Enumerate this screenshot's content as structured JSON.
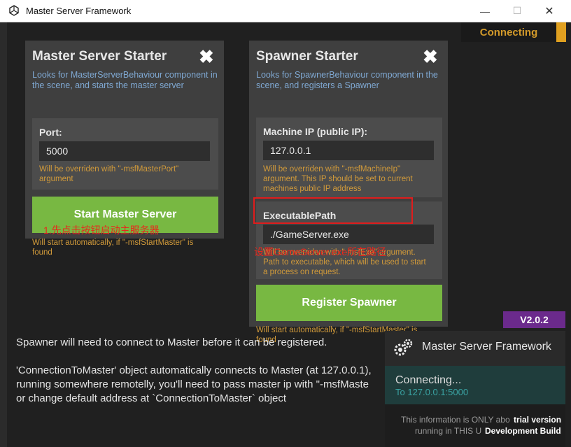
{
  "window": {
    "title": "Master Server Framework",
    "minimize_glyph": "—",
    "maximize_glyph": "☐",
    "close_glyph": "✕"
  },
  "top_status": {
    "text": "Connecting"
  },
  "master_panel": {
    "title": "Master Server Starter",
    "close_glyph": "✖",
    "description": "Looks for MasterServerBehaviour component in the scene, and starts the master server",
    "port_label": "Port:",
    "port_value": "5000",
    "port_warning": "Will be overriden with \"-msfMasterPort\" argument",
    "start_button": "Start Master Server",
    "auto_note": "Will start automatically, if \"-msfStartMaster\" is found",
    "annotation": "1.先点击按钮启动主服务器"
  },
  "spawner_panel": {
    "title": "Spawner Starter",
    "close_glyph": "✖",
    "description": "Looks for SpawnerBehaviour component in the scene, and registers a Spawner",
    "ip_label": "Machine IP (public IP):",
    "ip_value": "127.0.0.1",
    "ip_warning": "Will be overriden with \"-msfMachineIp\" argument. This IP should be set to current machines public IP address",
    "exe_label": "ExecutablePath",
    "exe_value": "./GameServer.exe",
    "exe_warning": "Will be overriden with \"-msfExe\" argument. Path to executable, which will be used to start a process on request.",
    "annotation": "设置GameServer.exe所在路径",
    "register_button": "Register Spawner",
    "auto_note": "Will start automatically, if \"-msfStartMaster\" is found"
  },
  "version_badge": "V2.0.2",
  "info": {
    "line1": "Spawner will need to connect to Master before it can be registered.",
    "line2": "'ConnectionToMaster' object automatically connects to Master (at 127.0.0.1),",
    "line3": "running somewhere remotelly, you'll need to pass master ip with \"-msfMaste",
    "line4": "or change default address at `ConnectionToMaster` object"
  },
  "msf_panel": {
    "name": "Master Server Framework",
    "status": "Connecting...",
    "target": "To 127.0.0.1:5000",
    "foot1": "This information is ONLY abo",
    "foot2": "running in THIS U"
  },
  "trial_label": "trial version",
  "dev_build_label": "Development Build",
  "colors": {
    "accent_green": "#78b842",
    "warning_orange": "#d19a3a",
    "desc_blue": "#7fa8d2",
    "annotation_red": "#e8281c",
    "version_purple": "#6b2a8c",
    "status_teal": "#1f3d3c"
  }
}
